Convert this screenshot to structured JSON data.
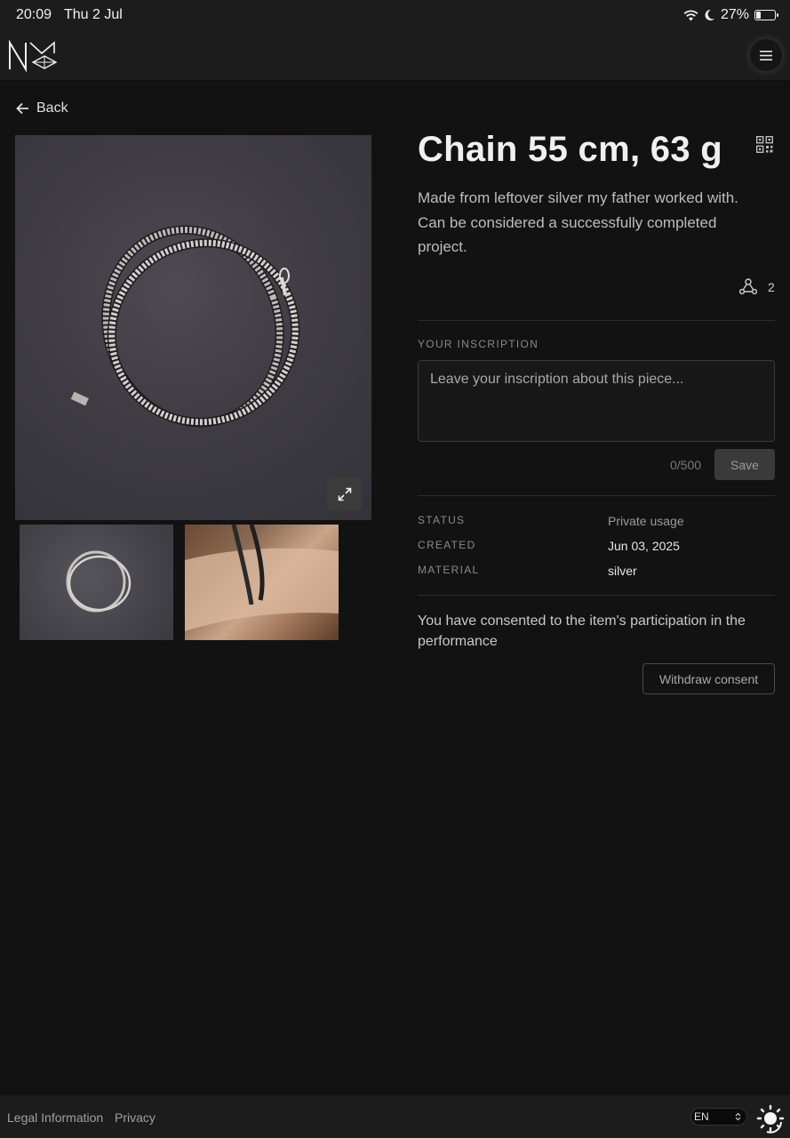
{
  "status_bar": {
    "time": "20:09",
    "date": "Thu 2 Jul",
    "battery": "27%",
    "battery_level": 0.27,
    "icons": [
      "wifi-icon",
      "moon-icon",
      "battery-icon"
    ]
  },
  "header": {
    "logo": "NM",
    "menu_icon": "hamburger-icon"
  },
  "nav": {
    "back_label": "Back"
  },
  "item": {
    "title": "Chain 55 cm, 63 g",
    "description": "Made from leftover silver my father worked with. Can be considered a successfully completed project.",
    "share_count": "2"
  },
  "inscription": {
    "label": "YOUR INSCRIPTION",
    "placeholder": "Leave your inscription about this piece...",
    "value": "",
    "counter": "0/500",
    "save_label": "Save"
  },
  "details": [
    {
      "label": "STATUS",
      "value": "Private usage"
    },
    {
      "label": "CREATED",
      "value": "Jun 03, 2025"
    },
    {
      "label": "MATERIAL",
      "value": "silver"
    }
  ],
  "consent": {
    "text": "You have consented to the item's participation in the performance",
    "withdraw_label": "Withdraw consent"
  },
  "footer": {
    "legal_label": "Legal Information",
    "privacy_label": "Privacy",
    "language": "EN"
  },
  "colors": {
    "background": "#121212",
    "header": "#1c1c1c",
    "text": "#e8e8e8",
    "muted": "#8a8a8a"
  }
}
